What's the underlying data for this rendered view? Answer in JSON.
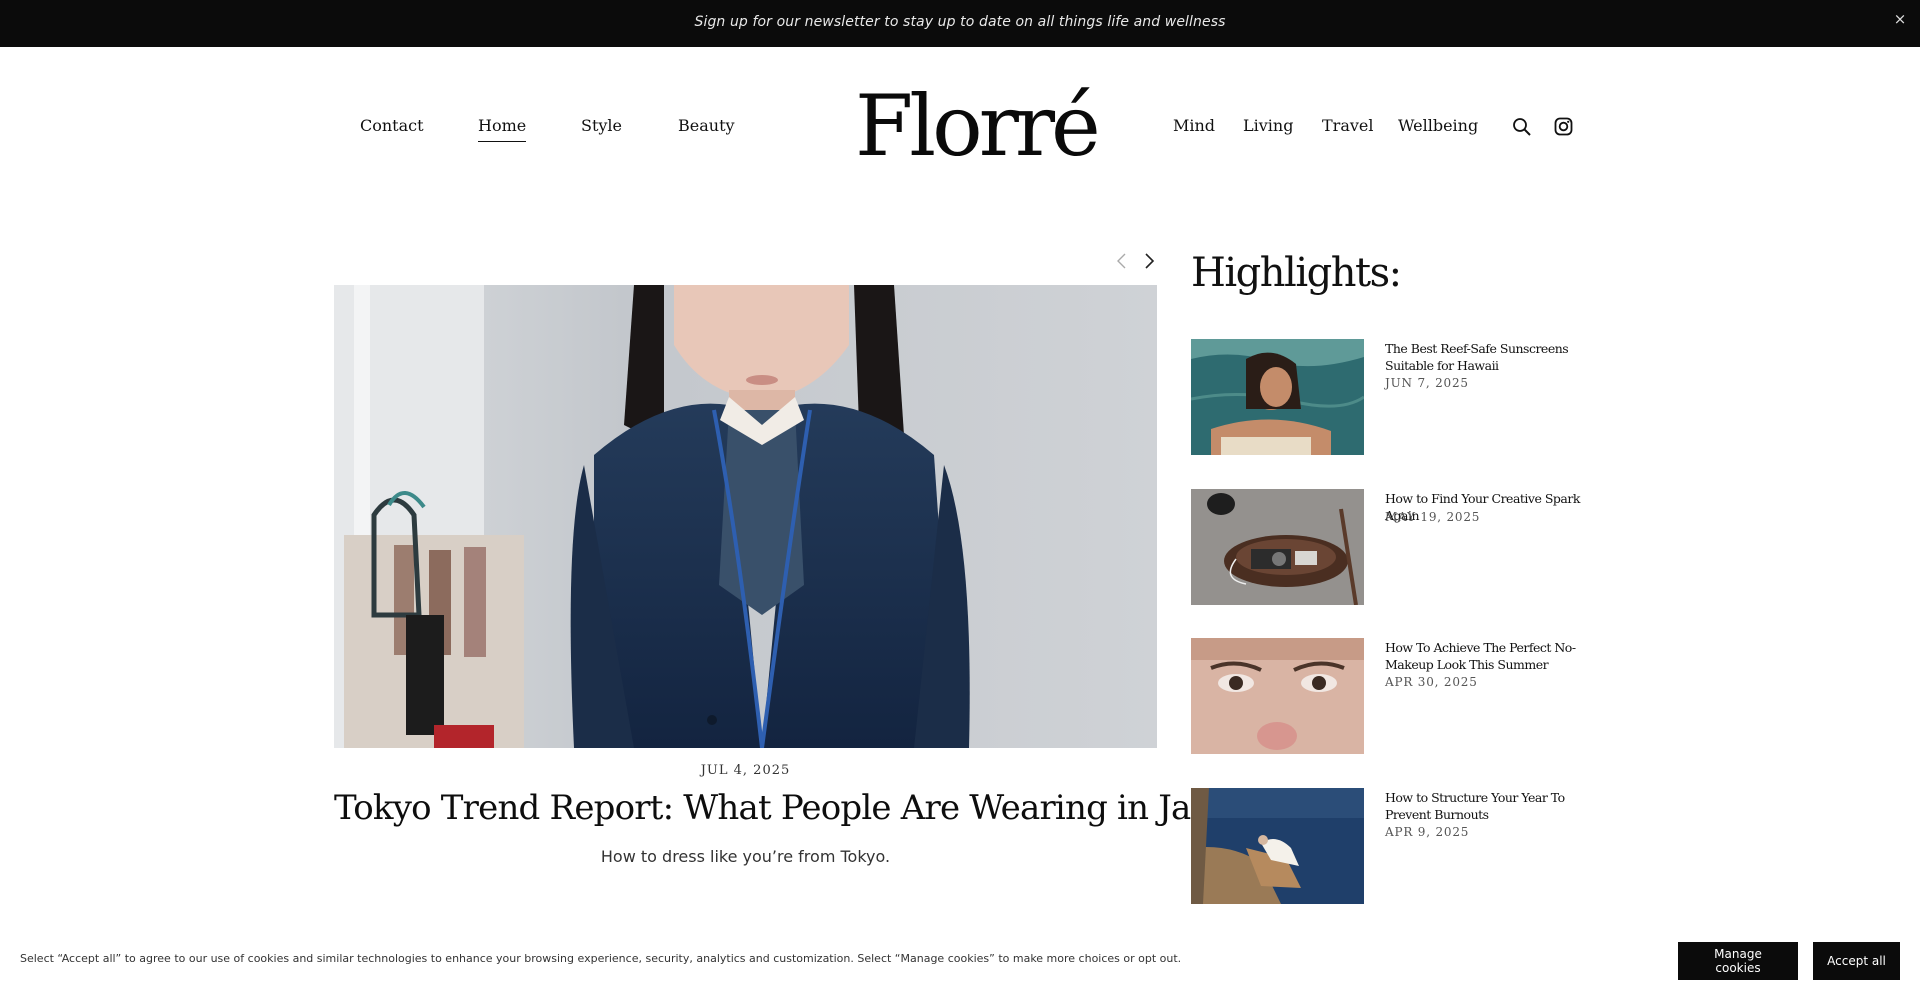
{
  "announcement": {
    "text": "Sign up for our newsletter to stay up to date on all things life and wellness",
    "close_label": "×"
  },
  "header": {
    "logo": "Florré",
    "nav_left": [
      {
        "label": "Contact"
      },
      {
        "label": "Home"
      },
      {
        "label": "Style"
      },
      {
        "label": "Beauty"
      }
    ],
    "nav_right": [
      {
        "label": "Mind"
      },
      {
        "label": "Living"
      },
      {
        "label": "Travel"
      },
      {
        "label": "Wellbeing"
      }
    ],
    "active_item": "Home",
    "icons": [
      "search-icon",
      "instagram-icon"
    ]
  },
  "featured": {
    "date": "JUL 4, 2025",
    "title": "Tokyo Trend Report: What People Are Wearing in Japan",
    "subtitle": "How to dress like you’re from Tokyo."
  },
  "highlights": {
    "heading": "Highlights:",
    "items": [
      {
        "title": "The Best Reef-Safe Sunscreens Suitable for Hawaii",
        "date": "JUN 7, 2025"
      },
      {
        "title": "How to Find Your Creative Spark Again",
        "date": "MAY 19, 2025"
      },
      {
        "title": "How To Achieve The Perfect No-Makeup Look This Summer",
        "date": "APR 30, 2025"
      },
      {
        "title": "How to Structure Your Year To Prevent Burnouts",
        "date": "APR 9, 2025"
      }
    ]
  },
  "cookies": {
    "text": "Select “Accept all” to agree to our use of cookies and similar technologies to enhance your browsing experience, security, analytics and customization. Select “Manage cookies” to make more choices or opt out.",
    "manage_label": "Manage cookies",
    "accept_label": "Accept all"
  }
}
